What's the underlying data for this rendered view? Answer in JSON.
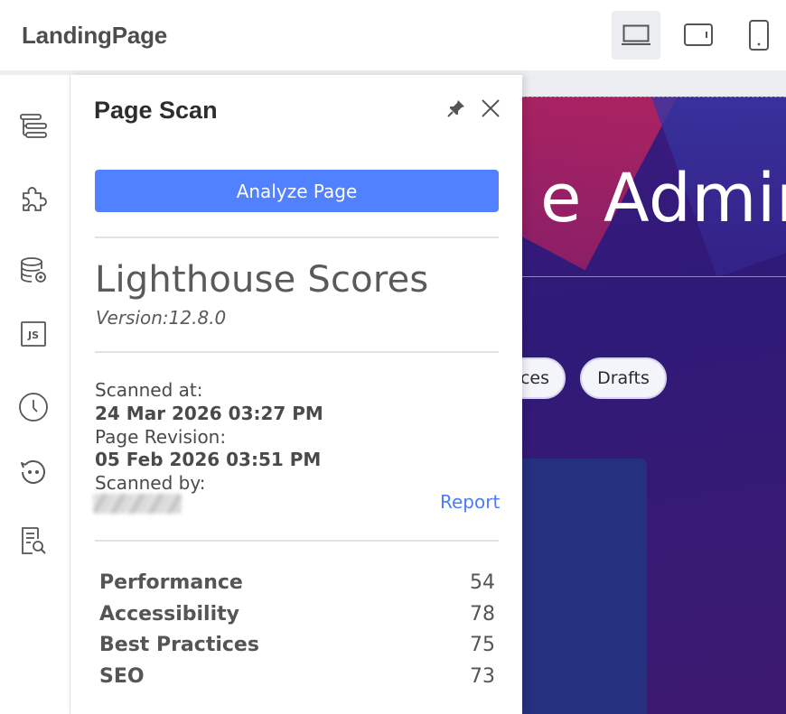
{
  "app": {
    "brand": "LandingPage",
    "devices": [
      {
        "name": "desktop",
        "active": true
      },
      {
        "name": "tablet",
        "active": false
      },
      {
        "name": "mobile",
        "active": false
      }
    ]
  },
  "rail": {
    "items": [
      {
        "icon": "layers-icon"
      },
      {
        "icon": "puzzle-icon"
      },
      {
        "icon": "database-settings-icon"
      },
      {
        "icon": "js-icon"
      },
      {
        "icon": "clock-icon"
      },
      {
        "icon": "face-icon"
      },
      {
        "icon": "document-search-icon"
      }
    ]
  },
  "preview": {
    "hero_title": "e Admin",
    "pills": [
      "ces",
      "Drafts"
    ]
  },
  "panel": {
    "title": "Page Scan",
    "analyze_label": "Analyze Page",
    "scores_heading": "Lighthouse Scores",
    "version": "Version:12.8.0",
    "scanned_at_label": "Scanned at:",
    "scanned_at_value": "24 Mar 2026 03:27 PM",
    "revision_label": "Page Revision:",
    "revision_value": "05 Feb 2026 03:51 PM",
    "scanned_by_label": "Scanned by:",
    "report_link": "Report",
    "scores": [
      {
        "name": "Performance",
        "value": "54"
      },
      {
        "name": "Accessibility",
        "value": "78"
      },
      {
        "name": "Best Practices",
        "value": "75"
      },
      {
        "name": "SEO",
        "value": "73"
      }
    ]
  },
  "colors": {
    "accent": "#5281ff",
    "link": "#4b7df8",
    "hero_bg": "#2f1a78"
  }
}
